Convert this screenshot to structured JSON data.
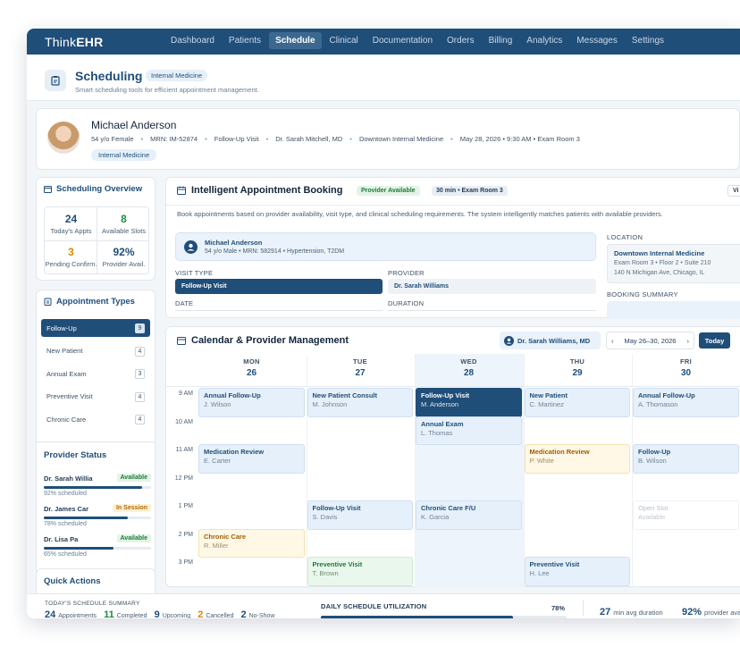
{
  "app": {
    "logo_prefix": "Think",
    "logo_bold": "EHR"
  },
  "nav": [
    {
      "label": "Dashboard",
      "active": false
    },
    {
      "label": "Patients",
      "active": false
    },
    {
      "label": "Schedule",
      "active": true
    },
    {
      "label": "Clinical",
      "active": false
    },
    {
      "label": "Documentation",
      "active": false
    },
    {
      "label": "Orders",
      "active": false
    },
    {
      "label": "Billing",
      "active": false
    },
    {
      "label": "Analytics",
      "active": false
    },
    {
      "label": "Messages",
      "active": false
    },
    {
      "label": "Settings",
      "active": false
    }
  ],
  "header": {
    "title": "Scheduling",
    "badge": "Internal Medicine",
    "subtitle": "Smart scheduling tools for efficient appointment management."
  },
  "patient": {
    "name": "Michael Anderson",
    "meta": [
      "54 y/o Female",
      "MRN: IM-52874",
      "Follow-Up Visit",
      "Dr. Sarah Mitchell, MD",
      "Downtown Internal Medicine",
      "May 28, 2026 • 9:30 AM • Exam Room 3"
    ],
    "tag": "Internal Medicine"
  },
  "overview": {
    "title": "Scheduling Overview",
    "stats": [
      {
        "value": "24",
        "label": "Today's Appts",
        "color": "#1f4e79"
      },
      {
        "value": "8",
        "label": "Available Slots",
        "color": "#1d8a3e"
      },
      {
        "value": "3",
        "label": "Pending Confirm.",
        "color": "#d98a00"
      },
      {
        "value": "92%",
        "label": "Provider Avail.",
        "color": "#1f4e79"
      }
    ]
  },
  "appointment_types": {
    "title": "Appointment Types",
    "items": [
      {
        "label": "Follow-Up",
        "count": "9",
        "active": true
      },
      {
        "label": "New Patient",
        "count": "4",
        "active": false
      },
      {
        "label": "Annual Exam",
        "count": "3",
        "active": false
      },
      {
        "label": "Preventive Visit",
        "count": "4",
        "active": false
      },
      {
        "label": "Chronic Care",
        "count": "4",
        "active": false
      }
    ]
  },
  "provider_status": {
    "title": "Provider Status",
    "providers": [
      {
        "name": "Dr. Sarah Willia",
        "status": "Available",
        "scheduled": "92% scheduled",
        "pct": 92,
        "status_bg": "#e3f4e6",
        "status_fg": "#1d7a3a"
      },
      {
        "name": "Dr. James Car",
        "status": "In Session",
        "scheduled": "78% scheduled",
        "pct": 78,
        "status_bg": "#fff1d6",
        "status_fg": "#b26a00"
      },
      {
        "name": "Dr. Lisa Pa",
        "status": "Available",
        "scheduled": "65% scheduled",
        "pct": 65,
        "status_bg": "#e3f4e6",
        "status_fg": "#1d7a3a"
      }
    ]
  },
  "quick_actions": {
    "title": "Quick Actions"
  },
  "booking": {
    "title": "Intelligent Appointment Booking",
    "pill_available": "Provider Available",
    "pill_slot": "30 min • Exam Room 3",
    "pill_right": "Vi",
    "description": "Book appointments based on provider availability, visit type, and clinical scheduling requirements. The system intelligently matches patients with available providers.",
    "patient_name": "Michael Anderson",
    "patient_meta": "54 y/o Male • MRN: 582914 • Hypertension, T2DM",
    "visit_type_label": "VISIT TYPE",
    "visit_type_value": "Follow-Up Visit",
    "provider_label": "PROVIDER",
    "provider_value": "Dr. Sarah Williams",
    "date_label": "DATE",
    "duration_label": "DURATION",
    "location_label": "LOCATION",
    "location_name": "Downtown Internal Medicine",
    "location_line1": "Exam Room 3 • Floor 2 • Suite 210",
    "location_line2": "140 N Michigan Ave, Chicago, IL",
    "summary_label": "BOOKING SUMMARY"
  },
  "calendar": {
    "title": "Calendar & Provider Management",
    "provider": "Dr. Sarah Williams, MD",
    "range": "May 26–30, 2026",
    "today_label": "Today",
    "days": [
      {
        "name": "MON",
        "date": "26"
      },
      {
        "name": "TUE",
        "date": "27"
      },
      {
        "name": "WED",
        "date": "28"
      },
      {
        "name": "THU",
        "date": "29"
      },
      {
        "name": "FRI",
        "date": "30"
      }
    ],
    "times": [
      "9 AM",
      "10 AM",
      "11 AM",
      "12 PM",
      "1 PM",
      "2 PM",
      "3 PM"
    ],
    "appointments": [
      {
        "day": 0,
        "title": "Annual Follow-Up",
        "name": "J. Wilson",
        "style": "blue",
        "start": 0
      },
      {
        "day": 1,
        "title": "New Patient Consult",
        "name": "M. Johnson",
        "style": "blue",
        "start": 0
      },
      {
        "day": 2,
        "title": "Follow-Up Visit",
        "name": "M. Anderson",
        "style": "dark",
        "start": 0
      },
      {
        "day": 3,
        "title": "New Patient",
        "name": "C. Martinez",
        "style": "blue",
        "start": 0
      },
      {
        "day": 4,
        "title": "Annual Follow-Up",
        "name": "A. Thomason",
        "style": "blue",
        "start": 0
      },
      {
        "day": 2,
        "title": "Annual Exam",
        "name": "L. Thomas",
        "style": "blue",
        "start": 1
      },
      {
        "day": 0,
        "title": "Medication Review",
        "name": "E. Carter",
        "style": "blue",
        "start": 2
      },
      {
        "day": 3,
        "title": "Medication Review",
        "name": "P. White",
        "style": "yellow",
        "start": 2
      },
      {
        "day": 4,
        "title": "Follow-Up",
        "name": "B. Wilson",
        "style": "blue",
        "start": 2
      },
      {
        "day": 1,
        "title": "Follow-Up Visit",
        "name": "S. Davis",
        "style": "blue",
        "start": 4
      },
      {
        "day": 2,
        "title": "Chronic Care F/U",
        "name": "K. Garcia",
        "style": "blue",
        "start": 4
      },
      {
        "day": 4,
        "title": "Open Slot",
        "name": "Available",
        "style": "open",
        "start": 4
      },
      {
        "day": 0,
        "title": "Chronic Care",
        "name": "R. Miller",
        "style": "yellow",
        "start": 5
      },
      {
        "day": 1,
        "title": "Preventive Visit",
        "name": "T. Brown",
        "style": "green",
        "start": 6
      },
      {
        "day": 3,
        "title": "Preventive Visit",
        "name": "H. Lee",
        "style": "blue",
        "start": 6
      }
    ]
  },
  "footer": {
    "summary_label": "TODAY'S SCHEDULE SUMMARY",
    "counts": [
      {
        "value": "24",
        "label": "Appointments"
      },
      {
        "value": "11",
        "label": "Completed"
      },
      {
        "value": "9",
        "label": "Upcoming"
      },
      {
        "value": "2",
        "label": "Cancelled"
      },
      {
        "value": "2",
        "label": "No-Show"
      }
    ],
    "utilization_label": "DAILY SCHEDULE UTILIZATION",
    "utilization_value": "78%",
    "utilization_pct": 78,
    "avg_duration_value": "27",
    "avg_duration_label": "min avg duration",
    "provider_avail_value": "92%",
    "provider_avail_label": "provider ava"
  }
}
